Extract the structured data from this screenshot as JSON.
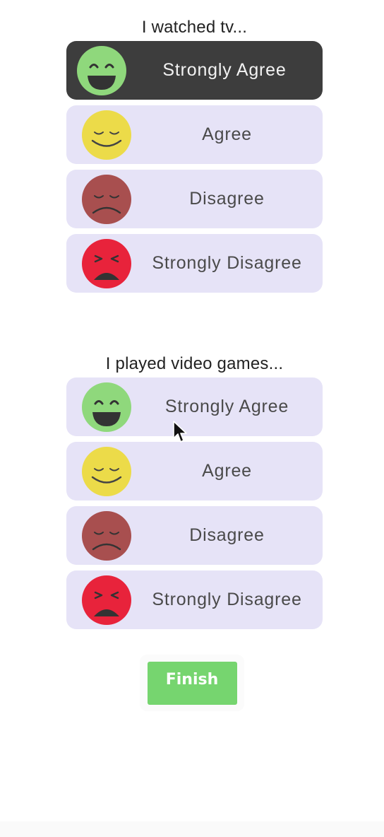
{
  "questions": [
    {
      "title": "I watched tv...",
      "selected": "Strongly Agree",
      "options": [
        {
          "label": "Strongly Agree",
          "face": "very-happy-face-icon"
        },
        {
          "label": "Agree",
          "face": "smiling-face-icon"
        },
        {
          "label": "Disagree",
          "face": "frowning-face-icon"
        },
        {
          "label": "Strongly Disagree",
          "face": "angry-face-icon"
        }
      ]
    },
    {
      "title": "I played video games...",
      "selected": "",
      "options": [
        {
          "label": "Strongly Agree",
          "face": "very-happy-face-icon"
        },
        {
          "label": "Agree",
          "face": "smiling-face-icon"
        },
        {
          "label": "Disagree",
          "face": "frowning-face-icon"
        },
        {
          "label": "Strongly Disagree",
          "face": "angry-face-icon"
        }
      ]
    }
  ],
  "finish_label": "Finish",
  "colors": {
    "option_bg": "#e6e3f7",
    "selected_bg": "#3d3d3d",
    "finish_bg": "#76d56f",
    "face_green": "#8fd87c",
    "face_yellow": "#ecdb49",
    "face_brown": "#a84f4f",
    "face_red": "#e8233b"
  }
}
